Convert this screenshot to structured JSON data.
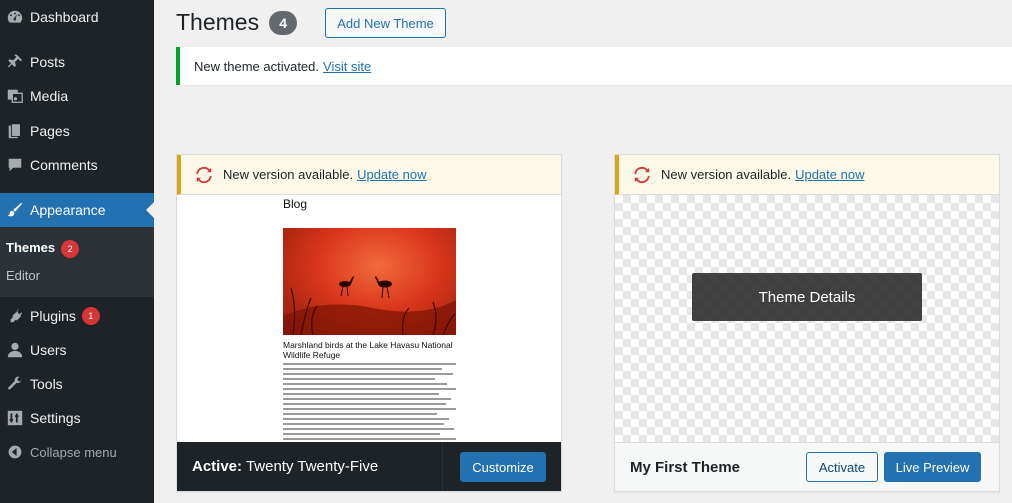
{
  "sidebar": {
    "items": [
      {
        "label": "Dashboard",
        "icon": "dashboard-icon"
      },
      {
        "label": "Posts",
        "icon": "pin-icon"
      },
      {
        "label": "Media",
        "icon": "media-icon"
      },
      {
        "label": "Pages",
        "icon": "pages-icon"
      },
      {
        "label": "Comments",
        "icon": "comment-icon"
      },
      {
        "label": "Appearance",
        "icon": "brush-icon"
      },
      {
        "label": "Plugins",
        "icon": "plug-icon",
        "badge": "1"
      },
      {
        "label": "Users",
        "icon": "user-icon"
      },
      {
        "label": "Tools",
        "icon": "wrench-icon"
      },
      {
        "label": "Settings",
        "icon": "settings-icon"
      }
    ],
    "submenu": [
      {
        "label": "Themes",
        "badge": "2"
      },
      {
        "label": "Editor"
      }
    ],
    "collapse_label": "Collapse menu"
  },
  "header": {
    "title": "Themes",
    "count": "4",
    "add_new_label": "Add New Theme"
  },
  "notice": {
    "text": "New theme activated.",
    "link": "Visit site"
  },
  "themes": [
    {
      "update_text": "New version available.",
      "update_link": "Update now",
      "preview": {
        "blog_label": "Blog",
        "caption": "Marshland birds at the Lake Havasu National Wildlife Refuge"
      },
      "active_prefix": "Active:",
      "name": "Twenty Twenty-Five",
      "button": "Customize"
    },
    {
      "update_text": "New version available.",
      "update_link": "Update now",
      "details_label": "Theme Details",
      "name": "My First Theme",
      "activate_label": "Activate",
      "preview_label": "Live Preview"
    }
  ],
  "colors": {
    "accent": "#2271b1",
    "sidebar_bg": "#1d2327",
    "badge": "#d63638",
    "success": "#00a32a",
    "warning": "#dba617"
  }
}
